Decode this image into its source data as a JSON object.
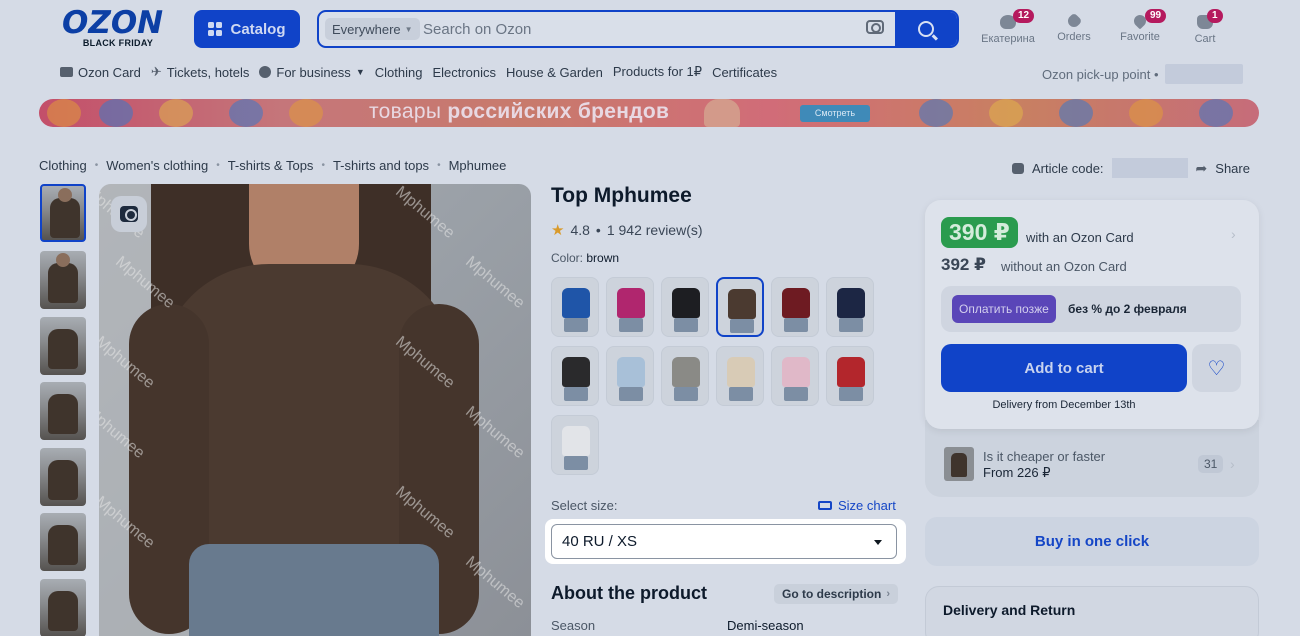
{
  "header": {
    "logo": "OZON",
    "logo_sub": "BLACK FRIDAY",
    "catalog_label": "Catalog",
    "search_scope": "Everywhere",
    "search_placeholder": "Search on Ozon",
    "items": [
      {
        "label": "Екатерина",
        "badge": "12",
        "icon": "user-icon"
      },
      {
        "label": "Orders",
        "badge": "",
        "icon": "box-icon"
      },
      {
        "label": "Favorite",
        "badge": "99",
        "icon": "heart-icon"
      },
      {
        "label": "Cart",
        "badge": "1",
        "icon": "cart-icon"
      }
    ]
  },
  "nav": {
    "items": [
      "Ozon Card",
      "Tickets, hotels",
      "For business",
      "Clothing",
      "Electronics",
      "House & Garden",
      "Products for 1₽",
      "Certificates"
    ],
    "pickup": "Ozon pick-up point •"
  },
  "banner": {
    "text_regular": "товары ",
    "text_bold": "российских брендов",
    "button": "Смотреть"
  },
  "breadcrumbs": [
    "Clothing",
    "Women's clothing",
    "T-shirts & Tops",
    "T-shirts and tops",
    "Mphumee"
  ],
  "article": {
    "label": "Article code:",
    "share": "Share"
  },
  "product": {
    "watermark": "Mphumee",
    "title": "Top Mphumee",
    "rating": "4.8",
    "reviews": "1 942 review(s)",
    "color_label": "Color:",
    "color_value": "brown",
    "swatch_colors": [
      "#1f55a8",
      "#b0266e",
      "#1d1e22",
      "#4b3a30",
      "#6e1b22",
      "#1c2644",
      "#2a2a2c",
      "#a8c0d8",
      "#8a8a86",
      "#d8cbb6",
      "#e0b8c8",
      "#b3262c",
      "#e2e4e8"
    ],
    "selected_color_index": 3,
    "size_label": "Select size:",
    "size_chart": "Size chart",
    "size_value": "40 RU / XS",
    "about": "About the product",
    "go_to_description": "Go to description",
    "season_key": "Season",
    "season_value": "Demi-season"
  },
  "price_card": {
    "price_with_card": "390 ₽",
    "with_card_label": "with an Ozon Card",
    "price_without": "392 ₽",
    "without_label": "without an Ozon Card",
    "pay_later_btn": "Оплатить позже",
    "pay_later_text": "без % до 2 февраля",
    "add_to_cart": "Add to cart",
    "delivery": "Delivery from December 13th",
    "cheaper_line1": "Is it cheaper or faster",
    "cheaper_line2": "From 226 ₽",
    "cheaper_count": "31",
    "buy_one_click": "Buy in one click",
    "delivery_return": "Delivery and Return"
  }
}
